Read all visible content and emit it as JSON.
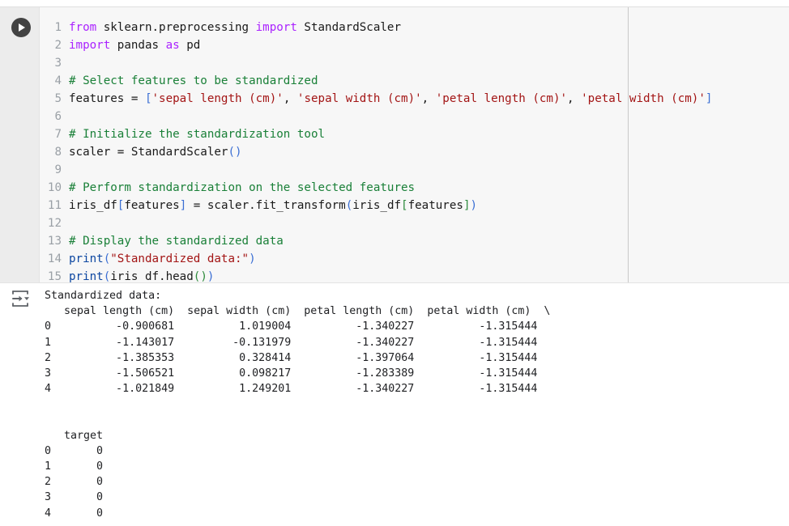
{
  "cell": {
    "type": "code-cell",
    "run_button_label": "Run cell",
    "run_icon": "play-circle-icon",
    "output_icon": "output-toggle-icon"
  },
  "colors": {
    "keyword": "#aa22ff",
    "comment": "#1a8038",
    "string": "#a31515",
    "function": "#0d47a1",
    "bracket_blue": "#3b6fd4",
    "bracket_green": "#2e8b3d",
    "bracket_red": "#b03030",
    "linenumber": "#9aa0a6",
    "code_background": "#f7f7f7",
    "gutter_background": "#ececec",
    "output_background": "#ffffff",
    "run_button_fill": "#434343"
  },
  "code": {
    "language": "python",
    "line_numbers": [
      1,
      2,
      3,
      4,
      5,
      6,
      7,
      8,
      9,
      10,
      11,
      12,
      13,
      14,
      15
    ],
    "lines": [
      "from sklearn.preprocessing import StandardScaler",
      "import pandas as pd",
      "",
      "# Select features to be standardized",
      "features = ['sepal length (cm)', 'sepal width (cm)', 'petal length (cm)', 'petal width (cm)']",
      "",
      "# Initialize the standardization tool",
      "scaler = StandardScaler()",
      "",
      "# Perform standardization on the selected features",
      "iris_df[features] = scaler.fit_transform(iris_df[features])",
      "",
      "# Display the standardized data",
      "print(\"Standardized data:\")",
      "print(iris_df.head())"
    ],
    "tokens": {
      "l1": {
        "kw1": "from",
        "mod": " sklearn.preprocessing ",
        "kw2": "import",
        "cls": " StandardScaler"
      },
      "l2": {
        "kw1": "import",
        "mod": " pandas ",
        "kw2": "as",
        "alias": " pd"
      },
      "l4": {
        "comment": "# Select features to be standardized"
      },
      "l5": {
        "name": "features = ",
        "open": "[",
        "s1": "'sepal length (cm)'",
        "c1": ", ",
        "s2": "'sepal width (cm)'",
        "c2": ", ",
        "s3": "'petal length (cm)'",
        "c3": ", ",
        "s4": "'petal width (cm)'",
        "close": "]"
      },
      "l7": {
        "comment": "# Initialize the standardization tool"
      },
      "l8": {
        "name": "scaler = StandardScaler",
        "open": "(",
        "close": ")"
      },
      "l10": {
        "comment": "# Perform standardization on the selected features"
      },
      "l11": {
        "p1": "iris_df",
        "b1o": "[",
        "p2": "features",
        "b1c": "]",
        "p3": " = scaler.fit_transform",
        "b2o": "(",
        "p4": "iris_df",
        "b3o": "[",
        "p5": "features",
        "b3c": "]",
        "b2c": ")"
      },
      "l13": {
        "comment": "# Display the standardized data"
      },
      "l14": {
        "fn": "print",
        "open": "(",
        "str": "\"Standardized data:\"",
        "close": ")"
      },
      "l15": {
        "fn": "print",
        "open": "(",
        "arg": "iris_df.head",
        "io": "(",
        "ic": ")",
        "close": ")"
      }
    }
  },
  "output": {
    "header_text": "Standardized data:",
    "table1": {
      "columns_line": "   sepal length (cm)  sepal width (cm)  petal length (cm)  petal width (cm)  \\",
      "column_names": [
        "sepal length (cm)",
        "sepal width (cm)",
        "petal length (cm)",
        "petal width (cm)"
      ],
      "continuation_marker": "\\",
      "index": [
        "0",
        "1",
        "2",
        "3",
        "4"
      ],
      "rows": [
        "0          -0.900681          1.019004          -1.340227          -1.315444",
        "1          -1.143017         -0.131979          -1.340227          -1.315444",
        "2          -1.385353          0.328414          -1.397064          -1.315444",
        "3          -1.506521          0.098217          -1.283389          -1.315444",
        "4          -1.021849          1.249201          -1.340227          -1.315444"
      ],
      "values": [
        [
          -0.900681,
          1.019004,
          -1.340227,
          -1.315444
        ],
        [
          -1.143017,
          -0.131979,
          -1.340227,
          -1.315444
        ],
        [
          -1.385353,
          0.328414,
          -1.397064,
          -1.315444
        ],
        [
          -1.506521,
          0.098217,
          -1.283389,
          -1.315444
        ],
        [
          -1.021849,
          1.249201,
          -1.340227,
          -1.315444
        ]
      ]
    },
    "table2": {
      "columns_line": "   target",
      "column_names": [
        "target"
      ],
      "index": [
        "0",
        "1",
        "2",
        "3",
        "4"
      ],
      "rows": [
        "0       0",
        "1       0",
        "2       0",
        "3       0",
        "4       0"
      ],
      "values": [
        0,
        0,
        0,
        0,
        0
      ]
    }
  }
}
